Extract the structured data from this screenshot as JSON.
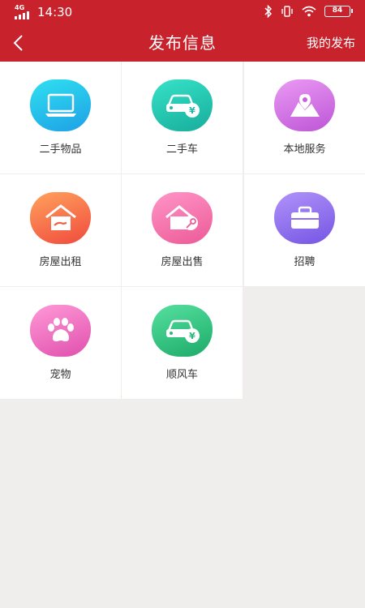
{
  "status_bar": {
    "network": "4G",
    "time": "14:30",
    "battery": "84"
  },
  "header": {
    "title": "发布信息",
    "right_action": "我的发布"
  },
  "categories": [
    {
      "label": "二手物品",
      "icon": "laptop-icon",
      "colors": [
        "#22d6ee",
        "#1aa7e8"
      ]
    },
    {
      "label": "二手车",
      "icon": "used-car-icon",
      "colors": [
        "#2fdcc0",
        "#19b6a6"
      ]
    },
    {
      "label": "本地服务",
      "icon": "map-pin-icon",
      "colors": [
        "#e08ff0",
        "#c05ad8"
      ]
    },
    {
      "label": "房屋出租",
      "icon": "house-rent-icon",
      "colors": [
        "#ff9a5c",
        "#f2533f"
      ]
    },
    {
      "label": "房屋出售",
      "icon": "house-sale-icon",
      "colors": [
        "#ff8fc4",
        "#f0609a"
      ]
    },
    {
      "label": "招聘",
      "icon": "briefcase-icon",
      "colors": [
        "#a88af8",
        "#7c5fe6"
      ]
    },
    {
      "label": "宠物",
      "icon": "paw-icon",
      "colors": [
        "#ff8fd2",
        "#e657b3"
      ]
    },
    {
      "label": "顺风车",
      "icon": "carpool-icon",
      "colors": [
        "#4fdc9a",
        "#22b36f"
      ]
    }
  ],
  "colors": {
    "header_bg": "#c8232c",
    "page_bg": "#efeeec"
  }
}
